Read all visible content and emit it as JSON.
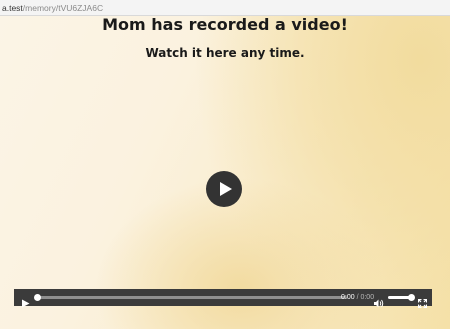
{
  "browser": {
    "url_host": "a.test",
    "url_path": "/memory/tVU6ZJA6C"
  },
  "page": {
    "title": "Mom has recorded a video!",
    "subtitle": "Watch it here any time."
  },
  "player": {
    "current_time": "0:00",
    "separator": " / ",
    "duration": "0:00",
    "progress": 0,
    "volume": 1.0,
    "icons": [
      "play-icon",
      "volume-icon",
      "fullscreen-icon"
    ]
  },
  "colors": {
    "background_light": "#fbf4e6",
    "background_warm": "#f5e1a8",
    "control_bar": "#3b3b3b",
    "play_button": "#333333"
  }
}
